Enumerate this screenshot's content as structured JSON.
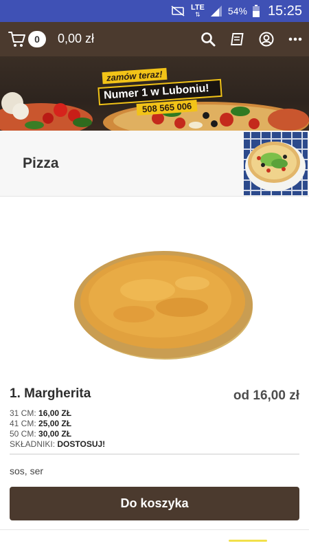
{
  "status_bar": {
    "network": "LTE",
    "battery": "54%",
    "time": "15:25"
  },
  "header": {
    "cart_count": "0",
    "cart_total": "0,00 zł",
    "icons": [
      "search-icon",
      "book-icon",
      "account-icon",
      "more-icon"
    ]
  },
  "banner": {
    "small_text": "zamów teraz!",
    "main_text": "Numer 1 w Luboniu!",
    "phone": "508 565 006"
  },
  "category": {
    "title": "Pizza"
  },
  "product": {
    "name": "1. Margherita",
    "price": "od 16,00 zł",
    "sizes": [
      {
        "label": "31 CM:",
        "price": "16,00 ZŁ"
      },
      {
        "label": "41 CM:",
        "price": "25,00 ZŁ"
      },
      {
        "label": "50 CM:",
        "price": "30,00 ZŁ"
      }
    ],
    "ingredients_label": "SKŁADNIKI:",
    "ingredients_action": "DOSTOSUJ!",
    "description": "sos, ser",
    "button_label": "Do koszyka"
  },
  "colors": {
    "status_bar": "#3f51b5",
    "brand_brown": "#4b3a2e",
    "accent_yellow": "#f2c318"
  }
}
